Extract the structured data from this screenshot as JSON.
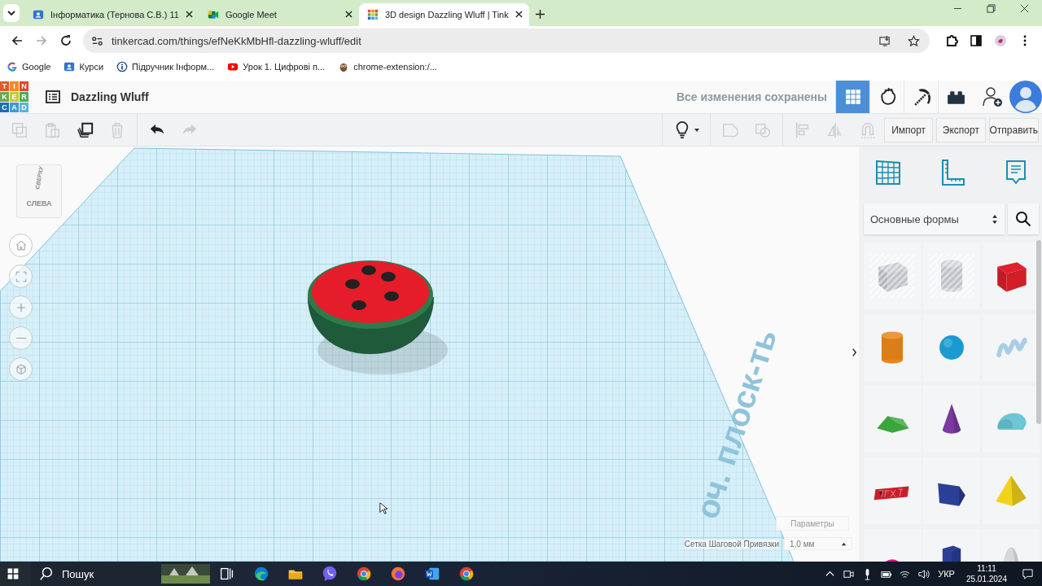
{
  "browser": {
    "tabs": [
      {
        "title": "Інформатика (Тернова С.В.) 11",
        "kind": "classroom",
        "selected": false
      },
      {
        "title": "Google Meet",
        "kind": "meet",
        "selected": false
      },
      {
        "title": "3D design Dazzling Wluff | Tink",
        "kind": "tinkercad",
        "selected": true
      }
    ],
    "url": "tinkercad.com/things/efNeKkMbHfl-dazzling-wluff/edit",
    "bookmarks": [
      {
        "label": "Google",
        "kind": "google"
      },
      {
        "label": "Курси",
        "kind": "classroom"
      },
      {
        "label": "Підручник Інформ...",
        "kind": "info"
      },
      {
        "label": "Урок 1. Цифрові п...",
        "kind": "youtube"
      },
      {
        "label": "chrome-extension:/...",
        "kind": "owl"
      }
    ]
  },
  "app": {
    "logo": [
      {
        "letter": "T",
        "color": "#e4572e"
      },
      {
        "letter": "I",
        "color": "#f08a24"
      },
      {
        "letter": "N",
        "color": "#e4442e"
      },
      {
        "letter": "K",
        "color": "#6aa84f"
      },
      {
        "letter": "E",
        "color": "#c9c92a"
      },
      {
        "letter": "R",
        "color": "#4caf50"
      },
      {
        "letter": "C",
        "color": "#1e6fb3"
      },
      {
        "letter": "A",
        "color": "#3d9bd6"
      },
      {
        "letter": "D",
        "color": "#5bb3e0"
      }
    ],
    "design_title": "Dazzling Wluff",
    "save_status": "Все изменения сохранены",
    "views": [
      {
        "kind": "grid",
        "selected": true
      },
      {
        "kind": "hand",
        "selected": false
      },
      {
        "kind": "pickaxe",
        "selected": false
      },
      {
        "kind": "brick",
        "selected": false
      }
    ]
  },
  "toolbar": {
    "tools": [
      {
        "kind": "copy",
        "disabled": true
      },
      {
        "kind": "paste",
        "disabled": true
      },
      {
        "kind": "duplicate",
        "disabled": false
      },
      {
        "kind": "delete",
        "disabled": true
      },
      {
        "kind": "undo",
        "disabled": false
      },
      {
        "kind": "redo",
        "disabled": true
      },
      {
        "kind": "bulb",
        "disabled": false
      },
      {
        "kind": "group",
        "disabled": true
      },
      {
        "kind": "ungroup",
        "disabled": true
      },
      {
        "kind": "align",
        "disabled": true
      },
      {
        "kind": "mirror",
        "disabled": true
      },
      {
        "kind": "magnet",
        "disabled": true
      }
    ],
    "actions": [
      "Импорт",
      "Экспорт",
      "Отправить"
    ]
  },
  "viewport": {
    "view_cube": {
      "top": "СВЕРХУ",
      "side": "СЛЕВА"
    },
    "nav": [
      {
        "kind": "home"
      },
      {
        "kind": "fit"
      },
      {
        "kind": "zoomin"
      },
      {
        "kind": "zoomout"
      },
      {
        "kind": "perspective"
      }
    ],
    "workplane_label": "оч. плоск-ть",
    "settings_button": "Параметры",
    "snap_label": "Сетка Шаговой Привязки",
    "snap_value": "1,0 мм"
  },
  "panel": {
    "category": "Основные формы",
    "shapes": [
      {
        "kind": "box",
        "color": "#c9cdd3",
        "hole": true
      },
      {
        "kind": "cylinder",
        "color": "#c9cdd3",
        "hole": true
      },
      {
        "kind": "box",
        "color": "#e0202c",
        "hole": false
      },
      {
        "kind": "cylinder",
        "color": "#e8861a",
        "hole": false
      },
      {
        "kind": "sphere",
        "color": "#1a9ad0",
        "hole": false
      },
      {
        "kind": "scribble",
        "color": "#a9cde6",
        "hole": false
      },
      {
        "kind": "roof",
        "color": "#3aa53a",
        "hole": false
      },
      {
        "kind": "cone",
        "color": "#7b3aa0",
        "hole": false
      },
      {
        "kind": "roundroof",
        "color": "#6cc6d4",
        "hole": false
      },
      {
        "kind": "text",
        "color": "#c8202a",
        "hole": false
      },
      {
        "kind": "polygon",
        "color": "#2b3f96",
        "hole": false
      },
      {
        "kind": "pyramid",
        "color": "#f2d21a",
        "hole": false
      },
      {
        "kind": "halfsphere",
        "color": "#e0108a",
        "hole": false
      },
      {
        "kind": "hexprism",
        "color": "#2b3f96",
        "hole": false
      },
      {
        "kind": "paraboloid",
        "color": "#d8d8d8",
        "hole": false
      }
    ]
  },
  "taskbar": {
    "search_placeholder": "Пошук",
    "apps": [
      {
        "kind": "taskview"
      },
      {
        "kind": "edge"
      },
      {
        "kind": "explorer"
      },
      {
        "kind": "viber"
      },
      {
        "kind": "chrome"
      },
      {
        "kind": "firefox"
      },
      {
        "kind": "word"
      },
      {
        "kind": "chrome"
      }
    ],
    "language": "УКР",
    "time": "11:11",
    "date": "25.01.2024"
  }
}
